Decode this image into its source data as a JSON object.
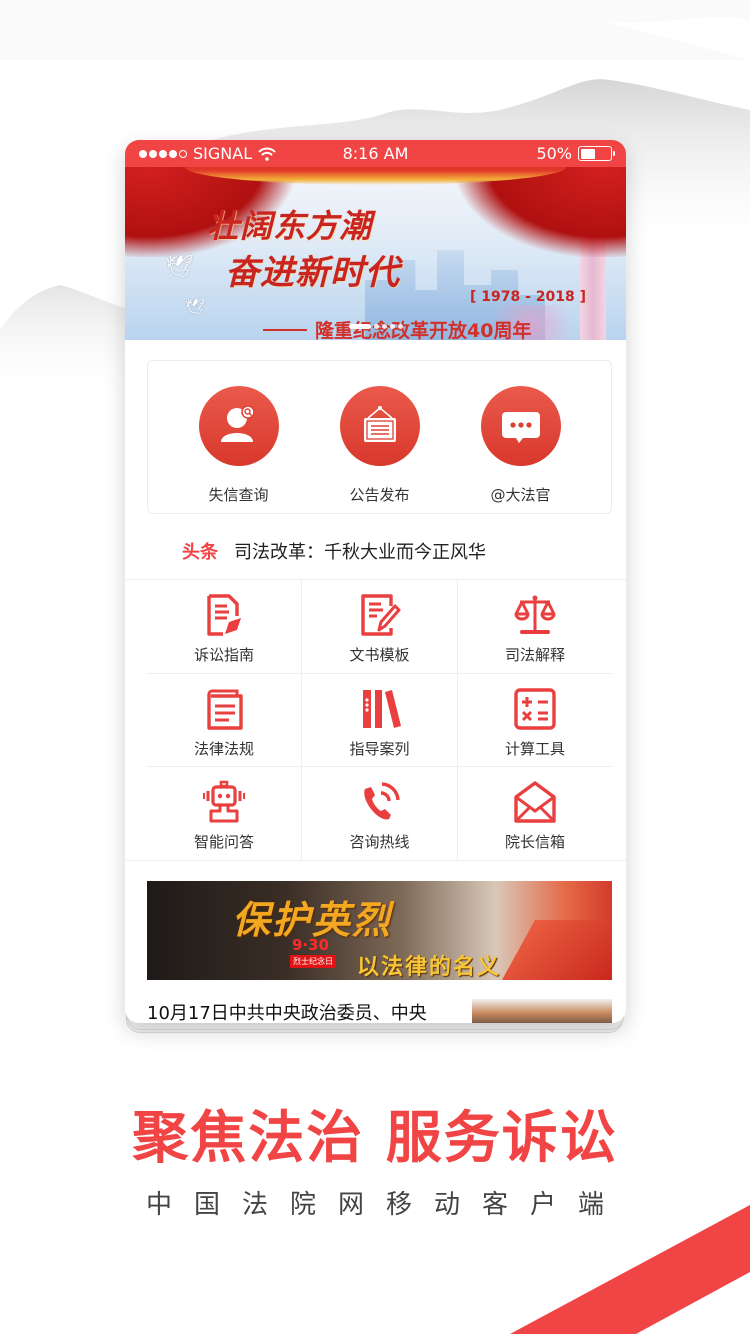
{
  "status_bar": {
    "signal_label": "SIGNAL",
    "signal_strength": "4 of 5",
    "time": "8:16 AM",
    "battery_percent_label": "50%",
    "battery_level": 0.5
  },
  "hero_banner": {
    "title_line1": "壮阔东方潮",
    "title_line2": "奋进新时代",
    "years": "[ 1978 - 2018 ]",
    "subtitle": "隆重纪念改革开放40周年",
    "pager": {
      "total": 5,
      "active_index": 0
    }
  },
  "quick_services": [
    {
      "label": "失信查询",
      "icon": "user-search-icon"
    },
    {
      "label": "公告发布",
      "icon": "notice-board-icon"
    },
    {
      "label": "@大法官",
      "icon": "chat-bubble-icon"
    }
  ],
  "headline": {
    "tag": "头条",
    "text": "司法改革：千秋大业而今正风华"
  },
  "service_grid": [
    {
      "label": "诉讼指南",
      "icon": "document-arrow-icon"
    },
    {
      "label": "文书模板",
      "icon": "document-pen-icon"
    },
    {
      "label": "司法解释",
      "icon": "scales-icon"
    },
    {
      "label": "法律法规",
      "icon": "book-icon"
    },
    {
      "label": "指导案列",
      "icon": "books-shelf-icon"
    },
    {
      "label": "计算工具",
      "icon": "calculator-icon"
    },
    {
      "label": "智能问答",
      "icon": "robot-icon"
    },
    {
      "label": "咨询热线",
      "icon": "phone-call-icon"
    },
    {
      "label": "院长信箱",
      "icon": "envelope-icon"
    }
  ],
  "promo_banner": {
    "title": "保护英烈",
    "date": "9·30",
    "date_caption": "烈士纪念日",
    "slogan": "以法律的名义"
  },
  "news": {
    "headline": "10月17日中共中央政治委员、中央"
  },
  "marketing": {
    "tagline": "聚焦法治 服务诉讼",
    "subline": "中国法院网移动客户端"
  },
  "colors": {
    "brand_red": "#f14545",
    "icon_red": "#e63c3c"
  }
}
